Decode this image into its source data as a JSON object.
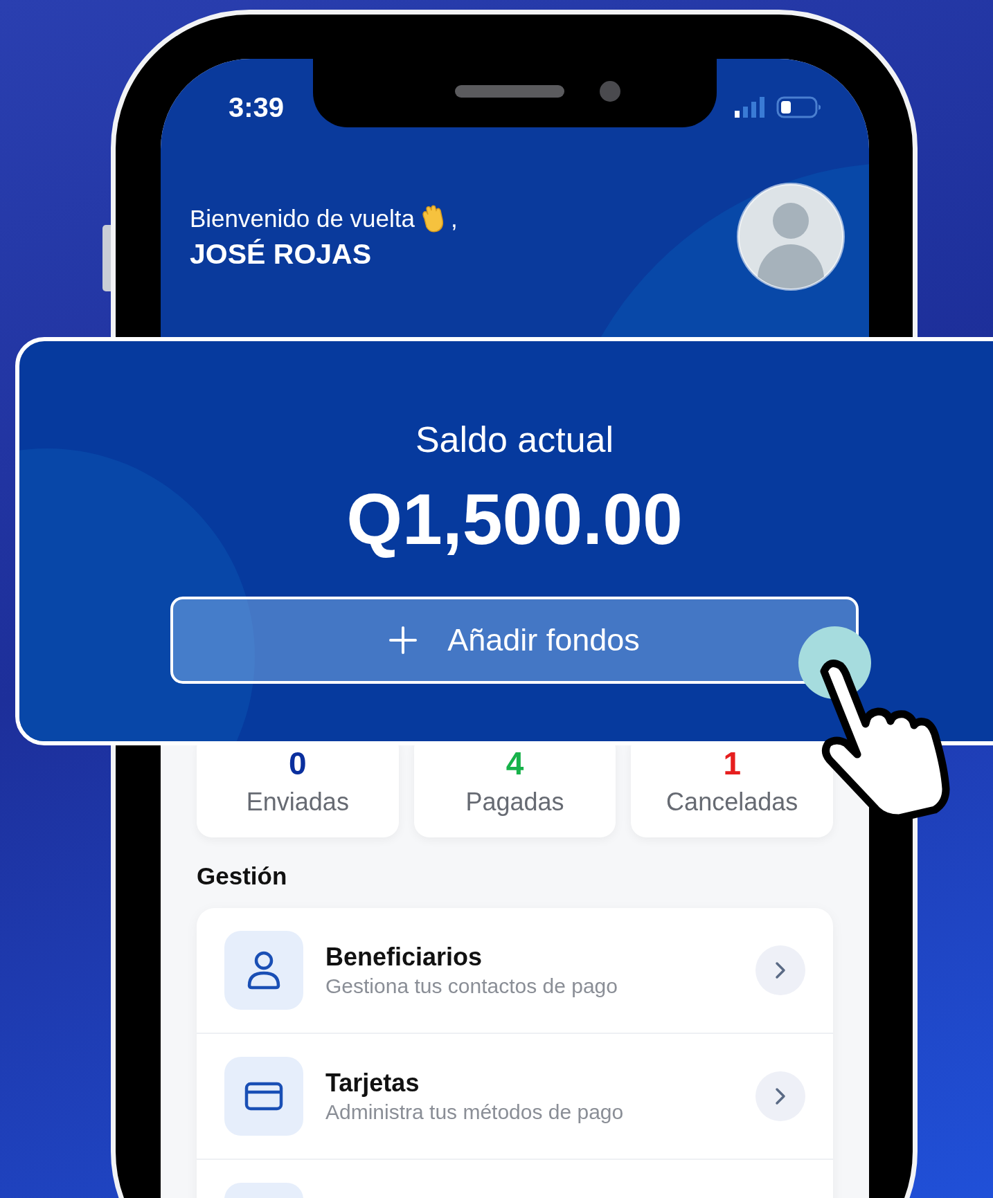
{
  "status_bar": {
    "time": "3:39"
  },
  "header": {
    "greeting": "Bienvenido de vuelta",
    "greeting_punctuation": ",",
    "name": "JOSÉ ROJAS"
  },
  "balance": {
    "label": "Saldo actual",
    "amount": "Q1,500.00",
    "add_button": "Añadir fondos"
  },
  "stats": [
    {
      "value": "0",
      "label": "Enviadas",
      "color": "#0a2f9e"
    },
    {
      "value": "4",
      "label": "Pagadas",
      "color": "#17b24a"
    },
    {
      "value": "1",
      "label": "Canceladas",
      "color": "#e61e1e"
    }
  ],
  "section_title": "Gestión",
  "menu": [
    {
      "kind": "person",
      "title": "Beneficiarios",
      "subtitle": "Gestiona tus contactos de pago"
    },
    {
      "kind": "card",
      "title": "Tarjetas",
      "subtitle": "Administra tus métodos de pago"
    },
    {
      "kind": "partial"
    }
  ]
}
